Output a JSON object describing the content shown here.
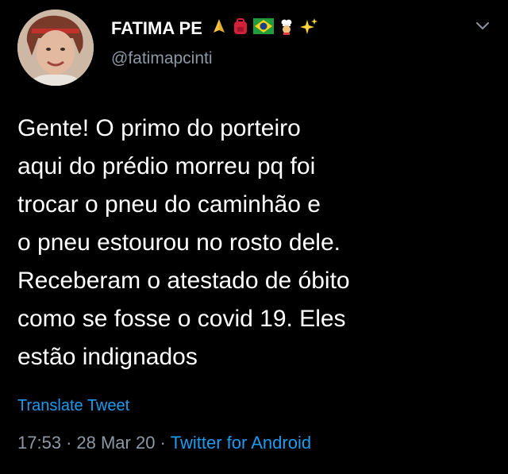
{
  "author": {
    "name": "FATIMA PE",
    "handle": "@fatimapcinti",
    "emojis": [
      "folded-hands-icon",
      "backpack-icon",
      "brazil-flag-icon",
      "chef-icon",
      "sparkles-icon"
    ]
  },
  "tweet": {
    "lines": [
      "Gente! O primo do porteiro",
      "aqui do prédio morreu pq foi",
      "trocar o pneu do caminhão e",
      "o pneu estourou no rosto dele.",
      "Receberam o atestado de óbito",
      "como se fosse o covid 19. Eles",
      "estão indignados"
    ],
    "translate_label": "Translate Tweet"
  },
  "meta": {
    "time": "17:53",
    "date": "28 Mar 20",
    "source": "Twitter for Android",
    "separator": "·"
  },
  "colors": {
    "background": "#000000",
    "text": "#ffffff",
    "muted": "#8b98a5",
    "link": "#1d9bf0"
  }
}
